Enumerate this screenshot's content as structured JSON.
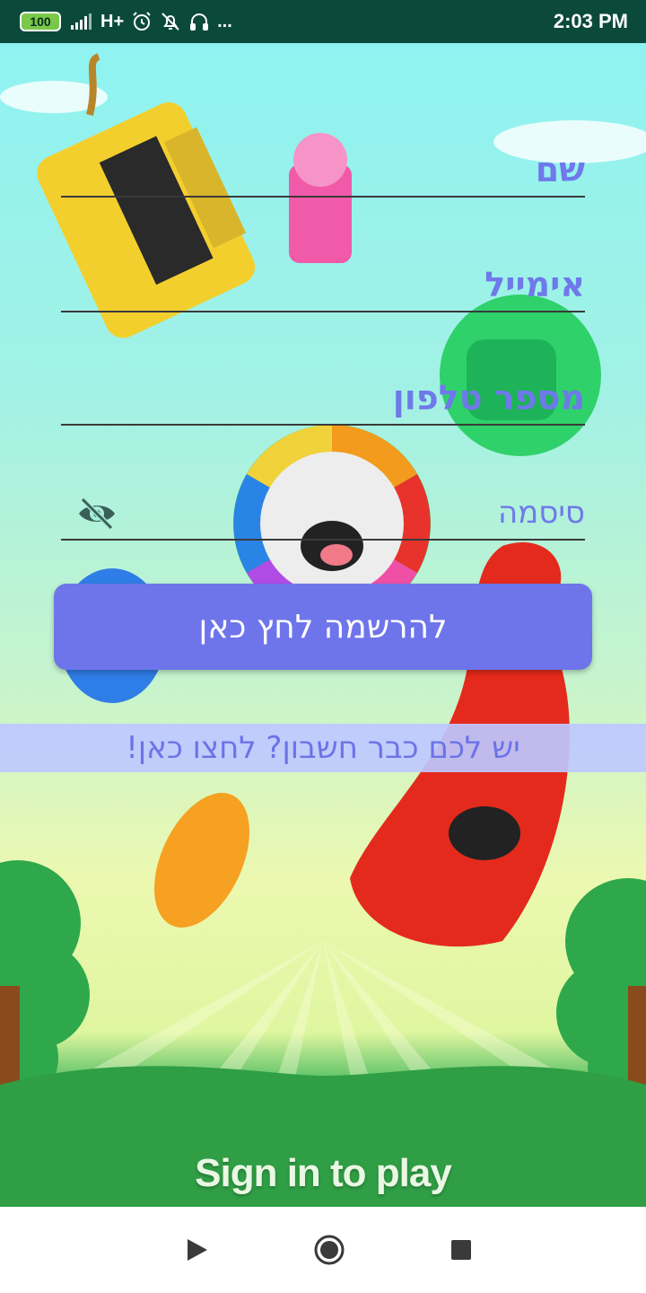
{
  "status_bar": {
    "battery": "100",
    "network": "H+",
    "time": "2:03 PM",
    "more": "..."
  },
  "form": {
    "name_label": "שם",
    "email_label": "אימייל",
    "phone_label": "מספר טלפון",
    "password_label": "סיסמה",
    "register_button": "להרשמה לחץ כאן",
    "login_link": "יש לכם כבר חשבון? לחצו כאן!"
  },
  "background": {
    "caption": "Sign in to play"
  },
  "colors": {
    "accent": "#6e75ea",
    "label": "#6f79ea",
    "status_bar": "#0b4a3a"
  },
  "icons": [
    "battery-icon",
    "signal-icon",
    "alarm-icon",
    "notifications-off-icon",
    "headset-icon",
    "eye-off-icon",
    "back-icon",
    "home-icon",
    "recents-icon"
  ]
}
